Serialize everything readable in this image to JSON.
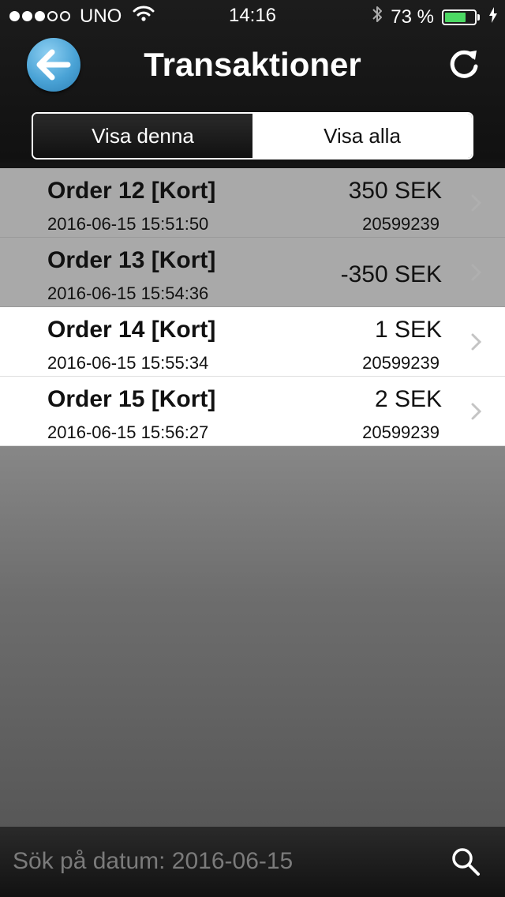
{
  "status_bar": {
    "carrier": "UNO",
    "time": "14:16",
    "battery_percent": "73 %",
    "battery_level": 0.73,
    "signal_bars_filled": 3,
    "signal_bars_total": 5
  },
  "nav": {
    "title": "Transaktioner",
    "back_icon": "back-arrow-icon",
    "refresh_icon": "refresh-icon"
  },
  "segments": {
    "show_this": "Visa denna",
    "show_all": "Visa alla",
    "selected": "show_this"
  },
  "transactions": [
    {
      "title": "Order 12 [Kort]",
      "amount": "350 SEK",
      "date": "2016-06-15 15:51:50",
      "reference": "20599239"
    },
    {
      "title": "Order 13 [Kort]",
      "amount": "-350 SEK",
      "date": "2016-06-15 15:54:36",
      "reference": ""
    },
    {
      "title": "Order 14 [Kort]",
      "amount": "1 SEK",
      "date": "2016-06-15 15:55:34",
      "reference": "20599239"
    },
    {
      "title": "Order 15 [Kort]",
      "amount": "2 SEK",
      "date": "2016-06-15 15:56:27",
      "reference": "20599239"
    }
  ],
  "search": {
    "placeholder": "Sök på datum: 2016-06-15",
    "value": ""
  },
  "colors": {
    "accent_blue": "#4aa3d6",
    "battery_green": "#4cd964",
    "dim_row": "#a9a9a9"
  }
}
